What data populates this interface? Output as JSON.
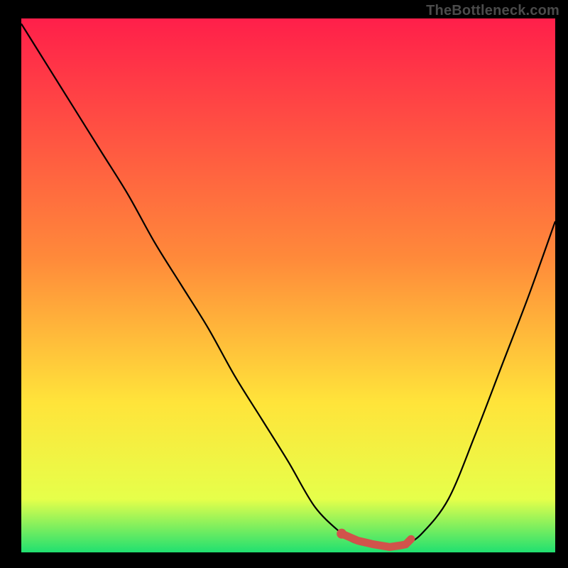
{
  "watermark": "TheBottleneck.com",
  "chart_data": {
    "type": "line",
    "title": "",
    "xlabel": "",
    "ylabel": "",
    "xlim": [
      0,
      100
    ],
    "ylim": [
      0,
      100
    ],
    "grid": false,
    "colors": {
      "curve": "#000000",
      "marker": "#d1534b",
      "gradient_top": "#ff1f4a",
      "gradient_mid": "#ffd63a",
      "gradient_bottom": "#20e070"
    },
    "series": [
      {
        "name": "bottleneck-curve",
        "x": [
          0,
          5,
          10,
          15,
          20,
          25,
          30,
          35,
          40,
          45,
          50,
          55,
          60,
          62,
          65,
          70,
          72,
          75,
          80,
          85,
          90,
          95,
          100
        ],
        "y": [
          99,
          91,
          83,
          75,
          67,
          58,
          50,
          42,
          33,
          25,
          17,
          8.5,
          3.5,
          2,
          1.2,
          0.8,
          1.5,
          3.5,
          10,
          22,
          35,
          48,
          62
        ]
      }
    ],
    "highlight": {
      "name": "optimal-range",
      "x": [
        60,
        63,
        66,
        69,
        71,
        72,
        73
      ],
      "y": [
        3.5,
        2.2,
        1.5,
        1.0,
        1.3,
        1.5,
        2.5
      ]
    }
  }
}
